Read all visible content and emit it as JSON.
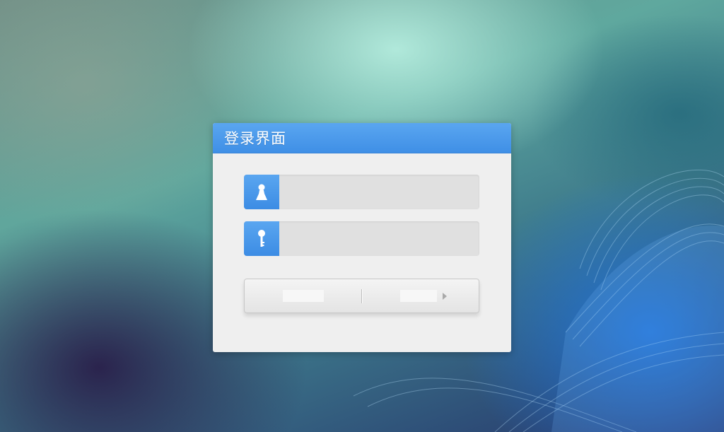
{
  "window": {
    "title": "登录界面"
  },
  "form": {
    "username": {
      "icon": "user-icon",
      "value": "",
      "placeholder": ""
    },
    "password": {
      "icon": "key-icon",
      "value": "",
      "placeholder": ""
    }
  },
  "buttons": {
    "login_label": "",
    "reset_label": "",
    "arrow_icon": "caret-right-icon"
  },
  "colors": {
    "accent": "#4a9af0",
    "panel_bg": "#efefef",
    "field_bg": "#e0e0e0"
  }
}
